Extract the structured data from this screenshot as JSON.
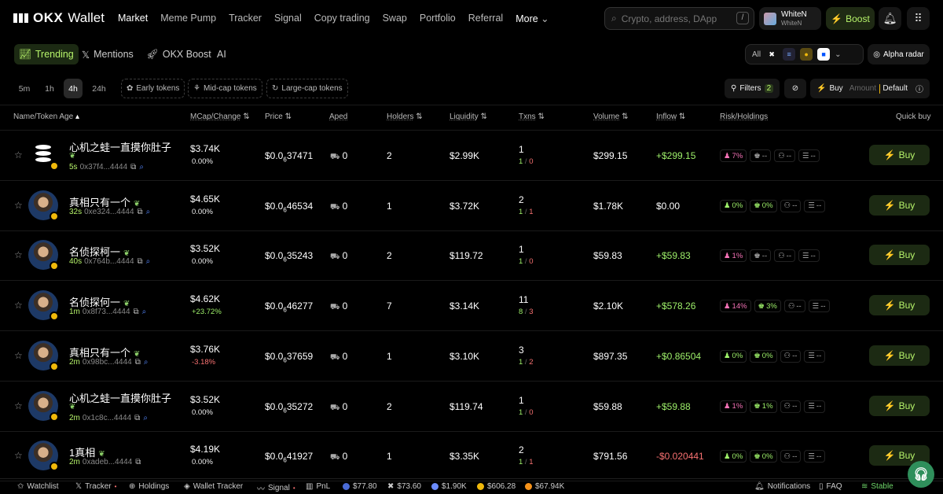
{
  "brand": {
    "logo_text": "OKX",
    "product": "Wallet"
  },
  "nav": {
    "items": [
      "Market",
      "Meme Pump",
      "Tracker",
      "Signal",
      "Copy trading",
      "Swap",
      "Portfolio",
      "Referral"
    ],
    "more": "More"
  },
  "search": {
    "placeholder": "Crypto, address, DApp",
    "shortcut": "/"
  },
  "user": {
    "name": "WhiteN",
    "sub": "WhiteN"
  },
  "boost_label": "Boost",
  "tabs": {
    "trending": "Trending",
    "mentions": "Mentions",
    "okx_boost": "OKX Boost",
    "ai": "AI"
  },
  "chain_filter": {
    "all": "All"
  },
  "alpha_radar": "Alpha radar",
  "timeframes": [
    "5m",
    "1h",
    "4h",
    "24h"
  ],
  "active_timeframe": "4h",
  "categories": {
    "early": "Early tokens",
    "mid": "Mid-cap tokens",
    "large": "Large-cap tokens"
  },
  "filters": {
    "label": "Filters",
    "count": "2"
  },
  "quickbuy": {
    "buy": "Buy",
    "amount": "Amount",
    "preset": "Default"
  },
  "columns": {
    "name": "Name/Token Age",
    "mcap": "MCap/Change",
    "price": "Price",
    "aped": "Aped",
    "holders": "Holders",
    "liquidity": "Liquidity",
    "txns": "Txns",
    "volume": "Volume",
    "inflow": "Inflow",
    "risk": "Risk/Holdings",
    "quick": "Quick buy"
  },
  "accent": "#b6f36a",
  "rows": [
    {
      "name": "心机之蛙一直摸你肚子",
      "age": "5s",
      "addr": "0x37f4...4444",
      "mcap": "$3.74K",
      "change": "0.00%",
      "price_pre": "$0.0",
      "price_sub": "6",
      "price_post": "37471",
      "aped": "0",
      "holders": "2",
      "liquidity": "$2.99K",
      "txns": "1",
      "buys": "1",
      "sells": "0",
      "volume": "$299.15",
      "inflow": "+$299.15",
      "r1": "7%",
      "r2": "--",
      "r3": "--",
      "r4": "--",
      "buy": "Buy"
    },
    {
      "name": "真相只有一个",
      "age": "32s",
      "addr": "0xe324...4444",
      "mcap": "$4.65K",
      "change": "0.00%",
      "price_pre": "$0.0",
      "price_sub": "6",
      "price_post": "46534",
      "aped": "0",
      "holders": "1",
      "liquidity": "$3.72K",
      "txns": "2",
      "buys": "1",
      "sells": "1",
      "volume": "$1.78K",
      "inflow": "$0.00",
      "r1": "0%",
      "r2": "0%",
      "r3": "--",
      "r4": "--",
      "buy": "Buy"
    },
    {
      "name": "名侦探柯一",
      "age": "40s",
      "addr": "0x764b...4444",
      "mcap": "$3.52K",
      "change": "0.00%",
      "price_pre": "$0.0",
      "price_sub": "6",
      "price_post": "35243",
      "aped": "0",
      "holders": "2",
      "liquidity": "$119.72",
      "txns": "1",
      "buys": "1",
      "sells": "0",
      "volume": "$59.83",
      "inflow": "+$59.83",
      "r1": "1%",
      "r2": "--",
      "r3": "--",
      "r4": "--",
      "buy": "Buy"
    },
    {
      "name": "名侦探何一",
      "age": "1m",
      "addr": "0x8f73...4444",
      "mcap": "$4.62K",
      "change": "+23.72%",
      "price_pre": "$0.0",
      "price_sub": "6",
      "price_post": "46277",
      "aped": "0",
      "holders": "7",
      "liquidity": "$3.14K",
      "txns": "11",
      "buys": "8",
      "sells": "3",
      "volume": "$2.10K",
      "inflow": "+$578.26",
      "r1": "14%",
      "r2": "3%",
      "r3": "--",
      "r4": "--",
      "buy": "Buy"
    },
    {
      "name": "真相只有一个",
      "age": "2m",
      "addr": "0x98bc...4444",
      "mcap": "$3.76K",
      "change": "-3.18%",
      "price_pre": "$0.0",
      "price_sub": "6",
      "price_post": "37659",
      "aped": "0",
      "holders": "1",
      "liquidity": "$3.10K",
      "txns": "3",
      "buys": "1",
      "sells": "2",
      "volume": "$897.35",
      "inflow": "+$0.86504",
      "r1": "0%",
      "r2": "0%",
      "r3": "--",
      "r4": "--",
      "buy": "Buy"
    },
    {
      "name": "心机之蛙一直摸你肚子",
      "age": "2m",
      "addr": "0x1c8c...4444",
      "mcap": "$3.52K",
      "change": "0.00%",
      "price_pre": "$0.0",
      "price_sub": "6",
      "price_post": "35272",
      "aped": "0",
      "holders": "2",
      "liquidity": "$119.74",
      "txns": "1",
      "buys": "1",
      "sells": "0",
      "volume": "$59.88",
      "inflow": "+$59.88",
      "r1": "1%",
      "r2": "1%",
      "r3": "--",
      "r4": "--",
      "buy": "Buy"
    },
    {
      "name": "1真相",
      "age": "2m",
      "addr": "0xadeb...4444",
      "mcap": "$4.19K",
      "change": "0.00%",
      "price_pre": "$0.0",
      "price_sub": "6",
      "price_post": "41927",
      "aped": "0",
      "holders": "1",
      "liquidity": "$3.35K",
      "txns": "2",
      "buys": "1",
      "sells": "1",
      "volume": "$791.56",
      "inflow": "-$0.020441",
      "r1": "0%",
      "r2": "0%",
      "r3": "--",
      "r4": "--",
      "buy": "Buy"
    }
  ],
  "footer": {
    "watchlist": "Watchlist",
    "tracker": "Tracker",
    "holdings": "Holdings",
    "wallet_tracker": "Wallet Tracker",
    "signal": "Signal",
    "pnl": "PnL",
    "p1": "$77.80",
    "p2": "$73.60",
    "p3": "$1.90K",
    "p4": "$606.28",
    "p5": "$67.94K",
    "notifications": "Notifications",
    "faq": "FAQ",
    "stable": "Stable"
  }
}
